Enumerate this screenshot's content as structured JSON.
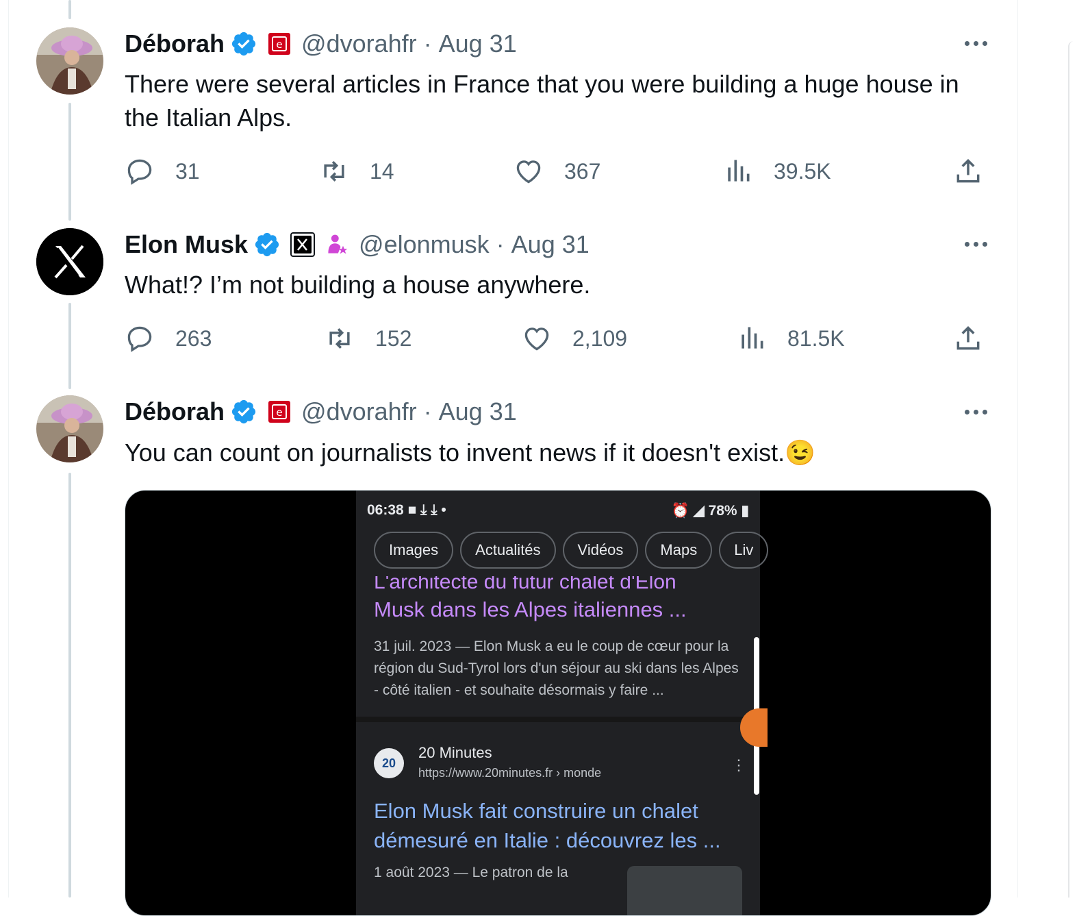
{
  "tweets": [
    {
      "name": "Déborah",
      "handle": "@dvorahfr",
      "separator": "·",
      "date": "Aug 31",
      "text": "There were several articles in France that you were building a huge house in the Italian Alps.",
      "replies": "31",
      "retweets": "14",
      "likes": "367",
      "views": "39.5K"
    },
    {
      "name": "Elon Musk",
      "handle": "@elonmusk",
      "separator": "·",
      "date": "Aug 31",
      "text": "What!? I’m not building a house anywhere.",
      "replies": "263",
      "retweets": "152",
      "likes": "2,109",
      "views": "81.5K"
    },
    {
      "name": "Déborah",
      "handle": "@dvorahfr",
      "separator": "·",
      "date": "Aug 31",
      "text": "You can count on journalists to invent news if it doesn't exist.",
      "emoji": "😉"
    }
  ],
  "media": {
    "status_time": "06:38",
    "status_icons_left": "■ ⤓ ⤓ •",
    "status_battery": "78%",
    "chips": [
      "Images",
      "Actualités",
      "Vidéos",
      "Maps",
      "Liv"
    ],
    "cut_title": "L'architecte du futur chalet d'Elon",
    "result1_title": "Musk dans les Alpes italiennes ...",
    "result1_snippet": "31 juil. 2023 — Elon Musk a eu le coup de cœur pour la région du Sud-Tyrol lors d'un séjour au ski dans les Alpes - côté italien - et souhaite désormais y faire ...",
    "source_logo": "20",
    "source_name": "20 Minutes",
    "source_url": "https://www.20minutes.fr › monde",
    "result2_title": "Elon Musk fait construire un chalet démesuré en Italie : découvrez les ...",
    "result2_date": "1 août 2023 — Le patron de la"
  },
  "colors": {
    "verified": "#1d9bf0",
    "text": "#0f1419",
    "muted": "#536471",
    "thread_line": "#cfd9de",
    "affiliate_red": "#d0021b"
  },
  "icons": [
    "reply-icon",
    "retweet-icon",
    "like-icon",
    "views-icon",
    "share-icon",
    "verified-badge-icon",
    "more-icon"
  ]
}
